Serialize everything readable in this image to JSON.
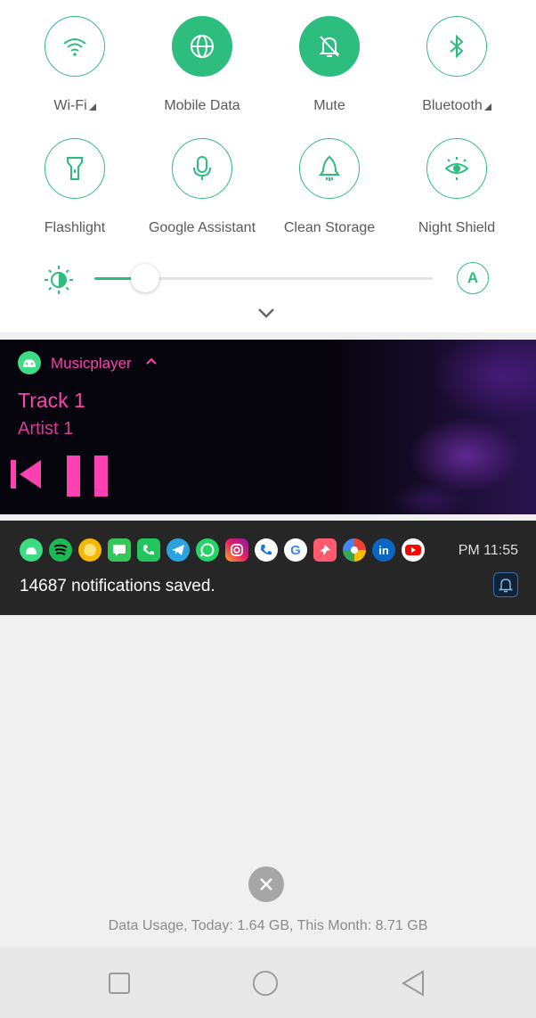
{
  "quick_settings": {
    "row1": [
      {
        "label": "Wi-Fi",
        "icon": "wifi-icon",
        "active": false,
        "has_menu": true
      },
      {
        "label": "Mobile Data",
        "icon": "globe-icon",
        "active": true,
        "has_menu": false
      },
      {
        "label": "Mute",
        "icon": "bell-mute-icon",
        "active": true,
        "has_menu": false
      },
      {
        "label": "Bluetooth",
        "icon": "bluetooth-icon",
        "active": false,
        "has_menu": true
      }
    ],
    "row2": [
      {
        "label": "Flashlight",
        "icon": "flashlight-icon",
        "active": false
      },
      {
        "label": "Google Assistant",
        "icon": "microphone-icon",
        "active": false
      },
      {
        "label": "Clean Storage",
        "icon": "rocket-icon",
        "active": false
      },
      {
        "label": "Night Shield",
        "icon": "eye-icon",
        "active": false
      }
    ],
    "brightness_level": 0.15,
    "auto_brightness_label": "A"
  },
  "media": {
    "app_name": "Musicplayer",
    "track": "Track 1",
    "artist": "Artist 1"
  },
  "notification": {
    "app_icons": [
      "android-icon",
      "spotify-icon",
      "sun-icon",
      "messages-icon",
      "phone-icon",
      "telegram-icon",
      "whatsapp-icon",
      "instagram-icon",
      "dialer-icon",
      "google-icon",
      "pin-icon",
      "photos-icon",
      "linkedin-icon",
      "youtube-icon"
    ],
    "time": "PM 11:55",
    "message": "14687 notifications saved."
  },
  "footer": {
    "data_usage": "Data Usage, Today: 1.64 GB, This Month: 8.71 GB"
  },
  "colors": {
    "accent": "#2dbd7f",
    "media_accent": "#ff40b0",
    "notification_bg": "#262626"
  }
}
